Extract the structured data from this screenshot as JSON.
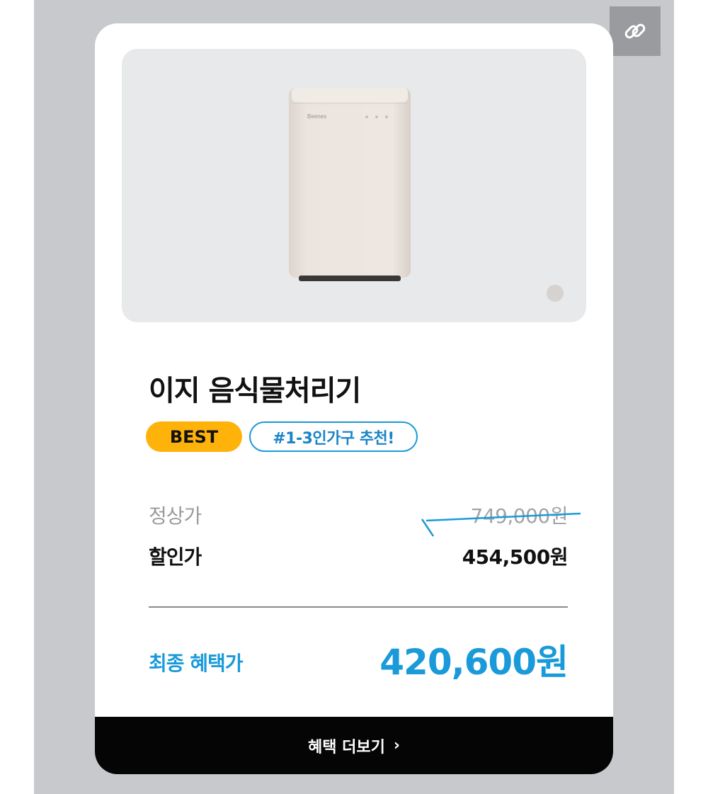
{
  "product": {
    "name": "이지 음식물처리기",
    "badges": {
      "best": "BEST",
      "tag": "#1-3인가구 추천!"
    },
    "image_alt": "Beenes food waste processor",
    "image_brand_text": "Beenes"
  },
  "pricing": {
    "regular_label": "정상가",
    "regular_price": "749,000원",
    "sale_label": "할인가",
    "sale_price": "454,500원",
    "final_label": "최종 혜택가",
    "final_price": "420,600원"
  },
  "cta": {
    "label": "혜택 더보기",
    "chevron": "›"
  },
  "icons": {
    "share": "link-icon",
    "chevron": "chevron-right-icon"
  },
  "colors": {
    "accent": "#1a9ad9",
    "best_badge": "#ffb20a",
    "button_bg": "#050505",
    "backdrop": "#c8c9cc"
  }
}
